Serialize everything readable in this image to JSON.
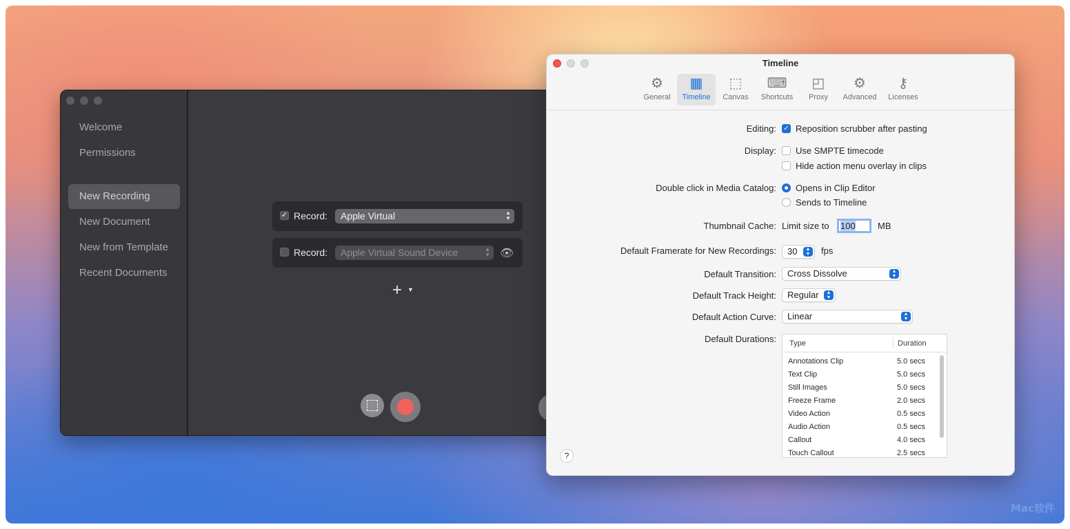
{
  "dark_window": {
    "sidebar": [
      {
        "label": "Welcome"
      },
      {
        "label": "Permissions"
      },
      {
        "label": "New Recording",
        "active": true
      },
      {
        "label": "New Document"
      },
      {
        "label": "New from Template"
      },
      {
        "label": "Recent Documents"
      }
    ],
    "record_rows": [
      {
        "label": "Record:",
        "device": "Apple Virtual",
        "checked": true
      },
      {
        "label": "Record:",
        "device": "Apple Virtual Sound Device",
        "checked": false
      }
    ],
    "icons": {
      "add": "plus-icon",
      "add_menu": "chevron-down-icon",
      "eye": "eye-icon",
      "selection": "selection-icon",
      "record": "record-icon"
    }
  },
  "preferences": {
    "title": "Timeline",
    "toolbar": [
      {
        "label": "General",
        "icon": "gear-icon"
      },
      {
        "label": "Timeline",
        "icon": "timeline-icon",
        "active": true
      },
      {
        "label": "Canvas",
        "icon": "canvas-icon"
      },
      {
        "label": "Shortcuts",
        "icon": "keyboard-icon"
      },
      {
        "label": "Proxy",
        "icon": "proxy-icon"
      },
      {
        "label": "Advanced",
        "icon": "gears-icon"
      },
      {
        "label": "Licenses",
        "icon": "key-icon"
      }
    ],
    "editing": {
      "label": "Editing:",
      "option": "Reposition scrubber after pasting",
      "checked": true
    },
    "display": {
      "label": "Display:",
      "options": [
        {
          "text": "Use SMPTE timecode",
          "checked": false
        },
        {
          "text": "Hide action menu overlay in clips",
          "checked": false
        }
      ]
    },
    "double_click": {
      "label": "Double click in Media Catalog:",
      "options": [
        {
          "text": "Opens in Clip Editor",
          "selected": true
        },
        {
          "text": "Sends to Timeline",
          "selected": false
        }
      ]
    },
    "thumbnail": {
      "label": "Thumbnail Cache:",
      "prefix": "Limit size to",
      "value": "100",
      "unit": "MB"
    },
    "framerate": {
      "label": "Default Framerate for New Recordings:",
      "value": "30",
      "unit": "fps"
    },
    "transition": {
      "label": "Default Transition:",
      "value": "Cross Dissolve"
    },
    "track_height": {
      "label": "Default Track Height:",
      "value": "Regular"
    },
    "action_curve": {
      "label": "Default Action Curve:",
      "value": "Linear"
    },
    "durations": {
      "label": "Default Durations:",
      "columns": [
        "Type",
        "Duration"
      ],
      "rows": [
        [
          "Annotations Clip",
          "5.0 secs"
        ],
        [
          "Text Clip",
          "5.0 secs"
        ],
        [
          "Still Images",
          "5.0 secs"
        ],
        [
          "Freeze Frame",
          "2.0 secs"
        ],
        [
          "Video Action",
          "0.5 secs"
        ],
        [
          "Audio Action",
          "0.5 secs"
        ],
        [
          "Callout",
          "4.0 secs"
        ],
        [
          "Touch Callout",
          "2.5 secs"
        ]
      ]
    },
    "help": "?"
  },
  "watermark": "Mac软件"
}
